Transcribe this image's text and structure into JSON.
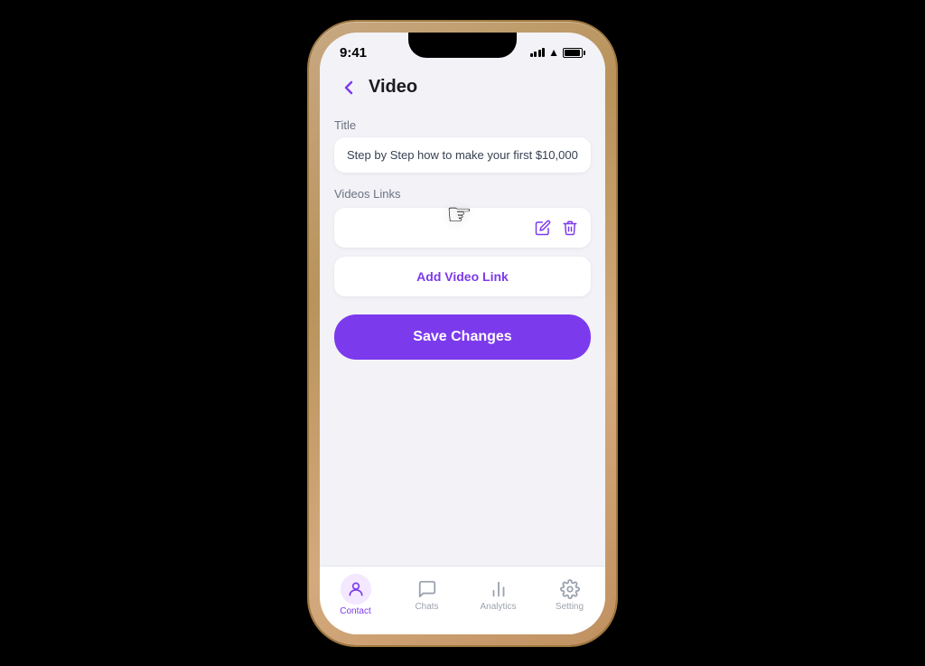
{
  "status_bar": {
    "time": "9:41",
    "signal_label": "signal",
    "wifi_label": "wifi",
    "battery_label": "battery"
  },
  "header": {
    "back_label": "‹",
    "title": "Video"
  },
  "form": {
    "title_label": "Title",
    "title_value": "Step by Step how to make your first $10,000",
    "videos_links_label": "Videos Links",
    "add_video_link_label": "Add Video Link",
    "save_changes_label": "Save Changes"
  },
  "bottom_nav": {
    "items": [
      {
        "id": "contact",
        "label": "Contact",
        "icon": "person",
        "active": true
      },
      {
        "id": "chats",
        "label": "Chats",
        "icon": "chat",
        "active": false
      },
      {
        "id": "analytics",
        "label": "Analytics",
        "icon": "analytics",
        "active": false
      },
      {
        "id": "setting",
        "label": "Setting",
        "icon": "gear",
        "active": false
      }
    ]
  }
}
